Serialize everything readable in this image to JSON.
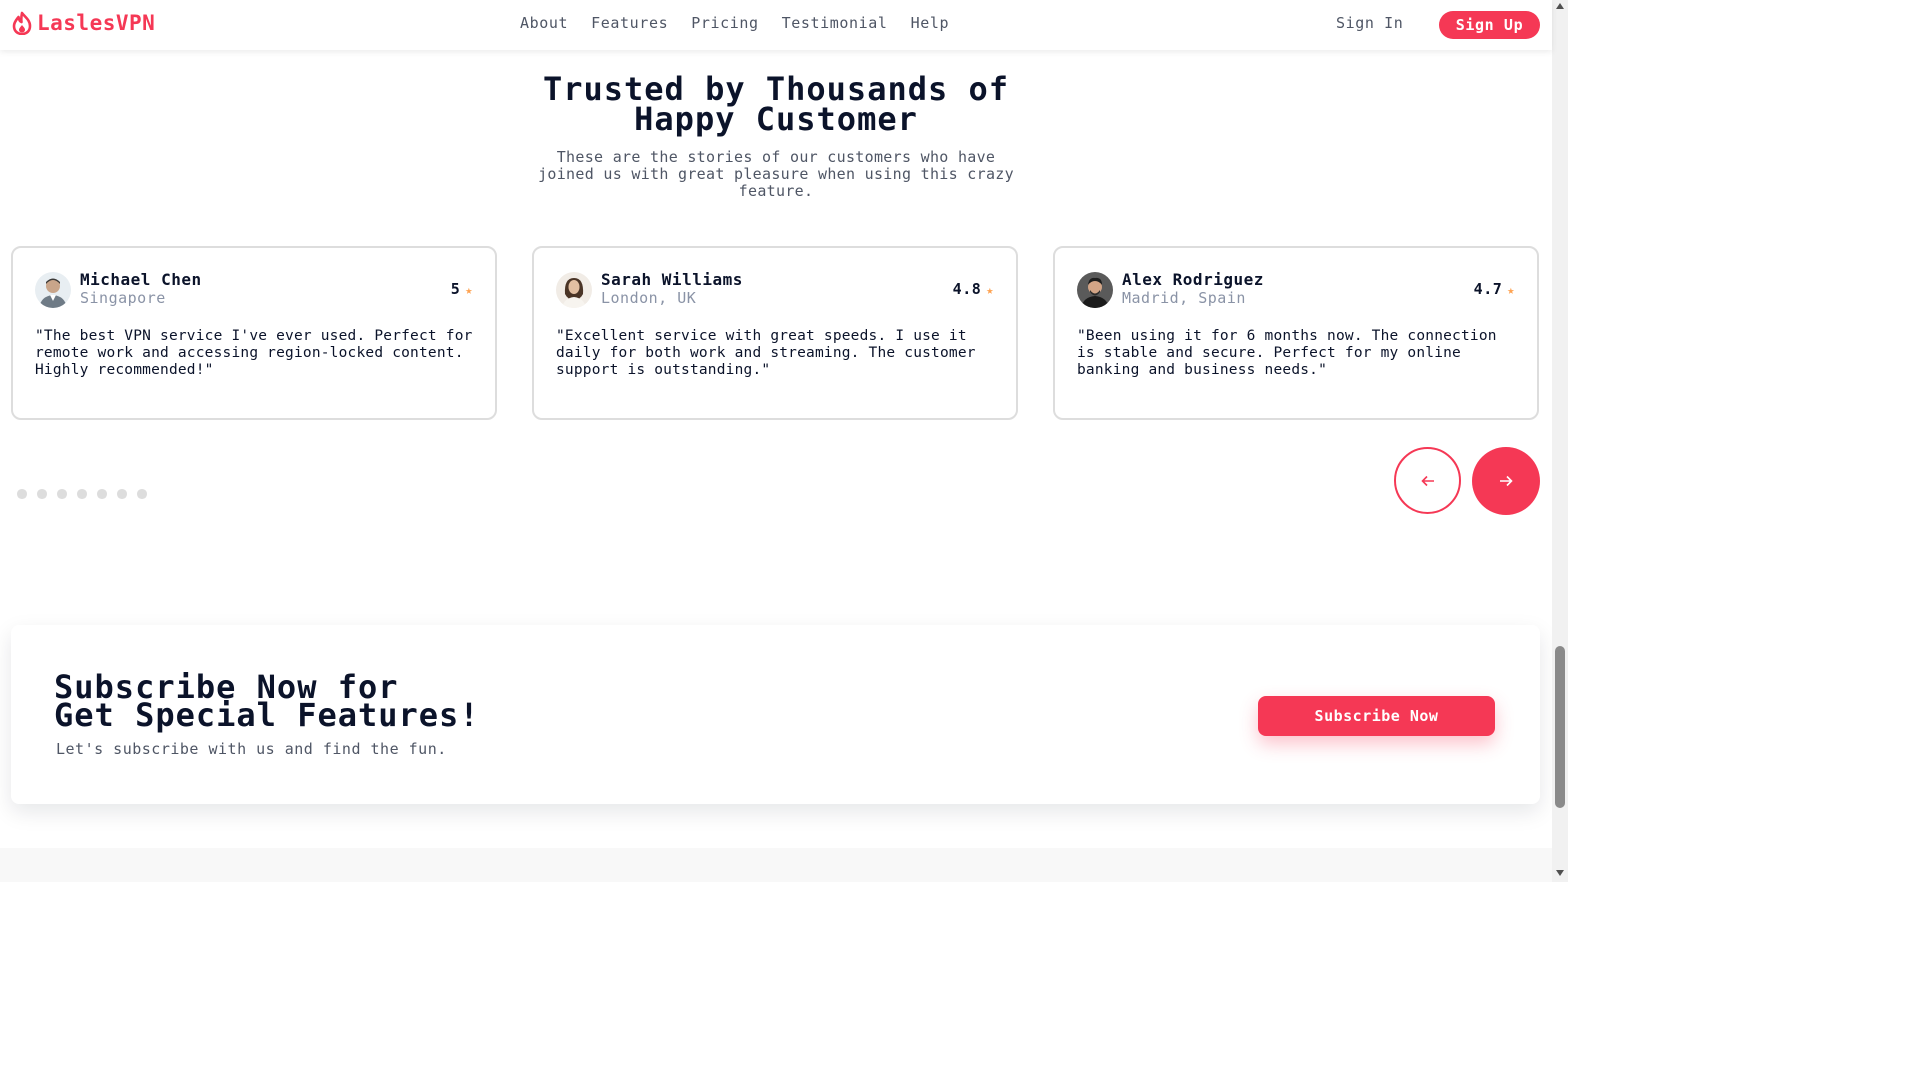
{
  "header": {
    "brand": "LaslesVPN",
    "nav": [
      "About",
      "Features",
      "Pricing",
      "Testimonial",
      "Help"
    ],
    "signin": "Sign In",
    "signup": "Sign Up"
  },
  "section": {
    "title_line1": "Trusted by Thousands of",
    "title_line2": "Happy Customer",
    "subtitle": "These are the stories of our customers who have joined us with great pleasure when using this crazy feature."
  },
  "testimonials": [
    {
      "name": "Michael Chen",
      "location": "Singapore",
      "rating": "5",
      "quote": "\"The best VPN service I've ever used. Perfect for remote work and accessing region-locked content. Highly recommended!\""
    },
    {
      "name": "Sarah Williams",
      "location": "London, UK",
      "rating": "4.8",
      "quote": "\"Excellent service with great speeds. I use it daily for both work and streaming. The customer support is outstanding.\""
    },
    {
      "name": "Alex Rodriguez",
      "location": "Madrid, Spain",
      "rating": "4.7",
      "quote": "\"Been using it for 6 months now. The connection is stable and secure. Perfect for my online banking and business needs.\""
    }
  ],
  "carousel": {
    "dot_count": 7,
    "prev_icon": "arrow-left-icon",
    "next_icon": "arrow-right-icon"
  },
  "subscribe": {
    "title_line1": "Subscribe Now for",
    "title_line2": "Get Special Features!",
    "text": "Let's subscribe with us and find the fun.",
    "button": "Subscribe Now"
  },
  "colors": {
    "accent": "#f53855",
    "star": "#fea250",
    "heading": "#0b132a",
    "muted": "#4f5665"
  }
}
